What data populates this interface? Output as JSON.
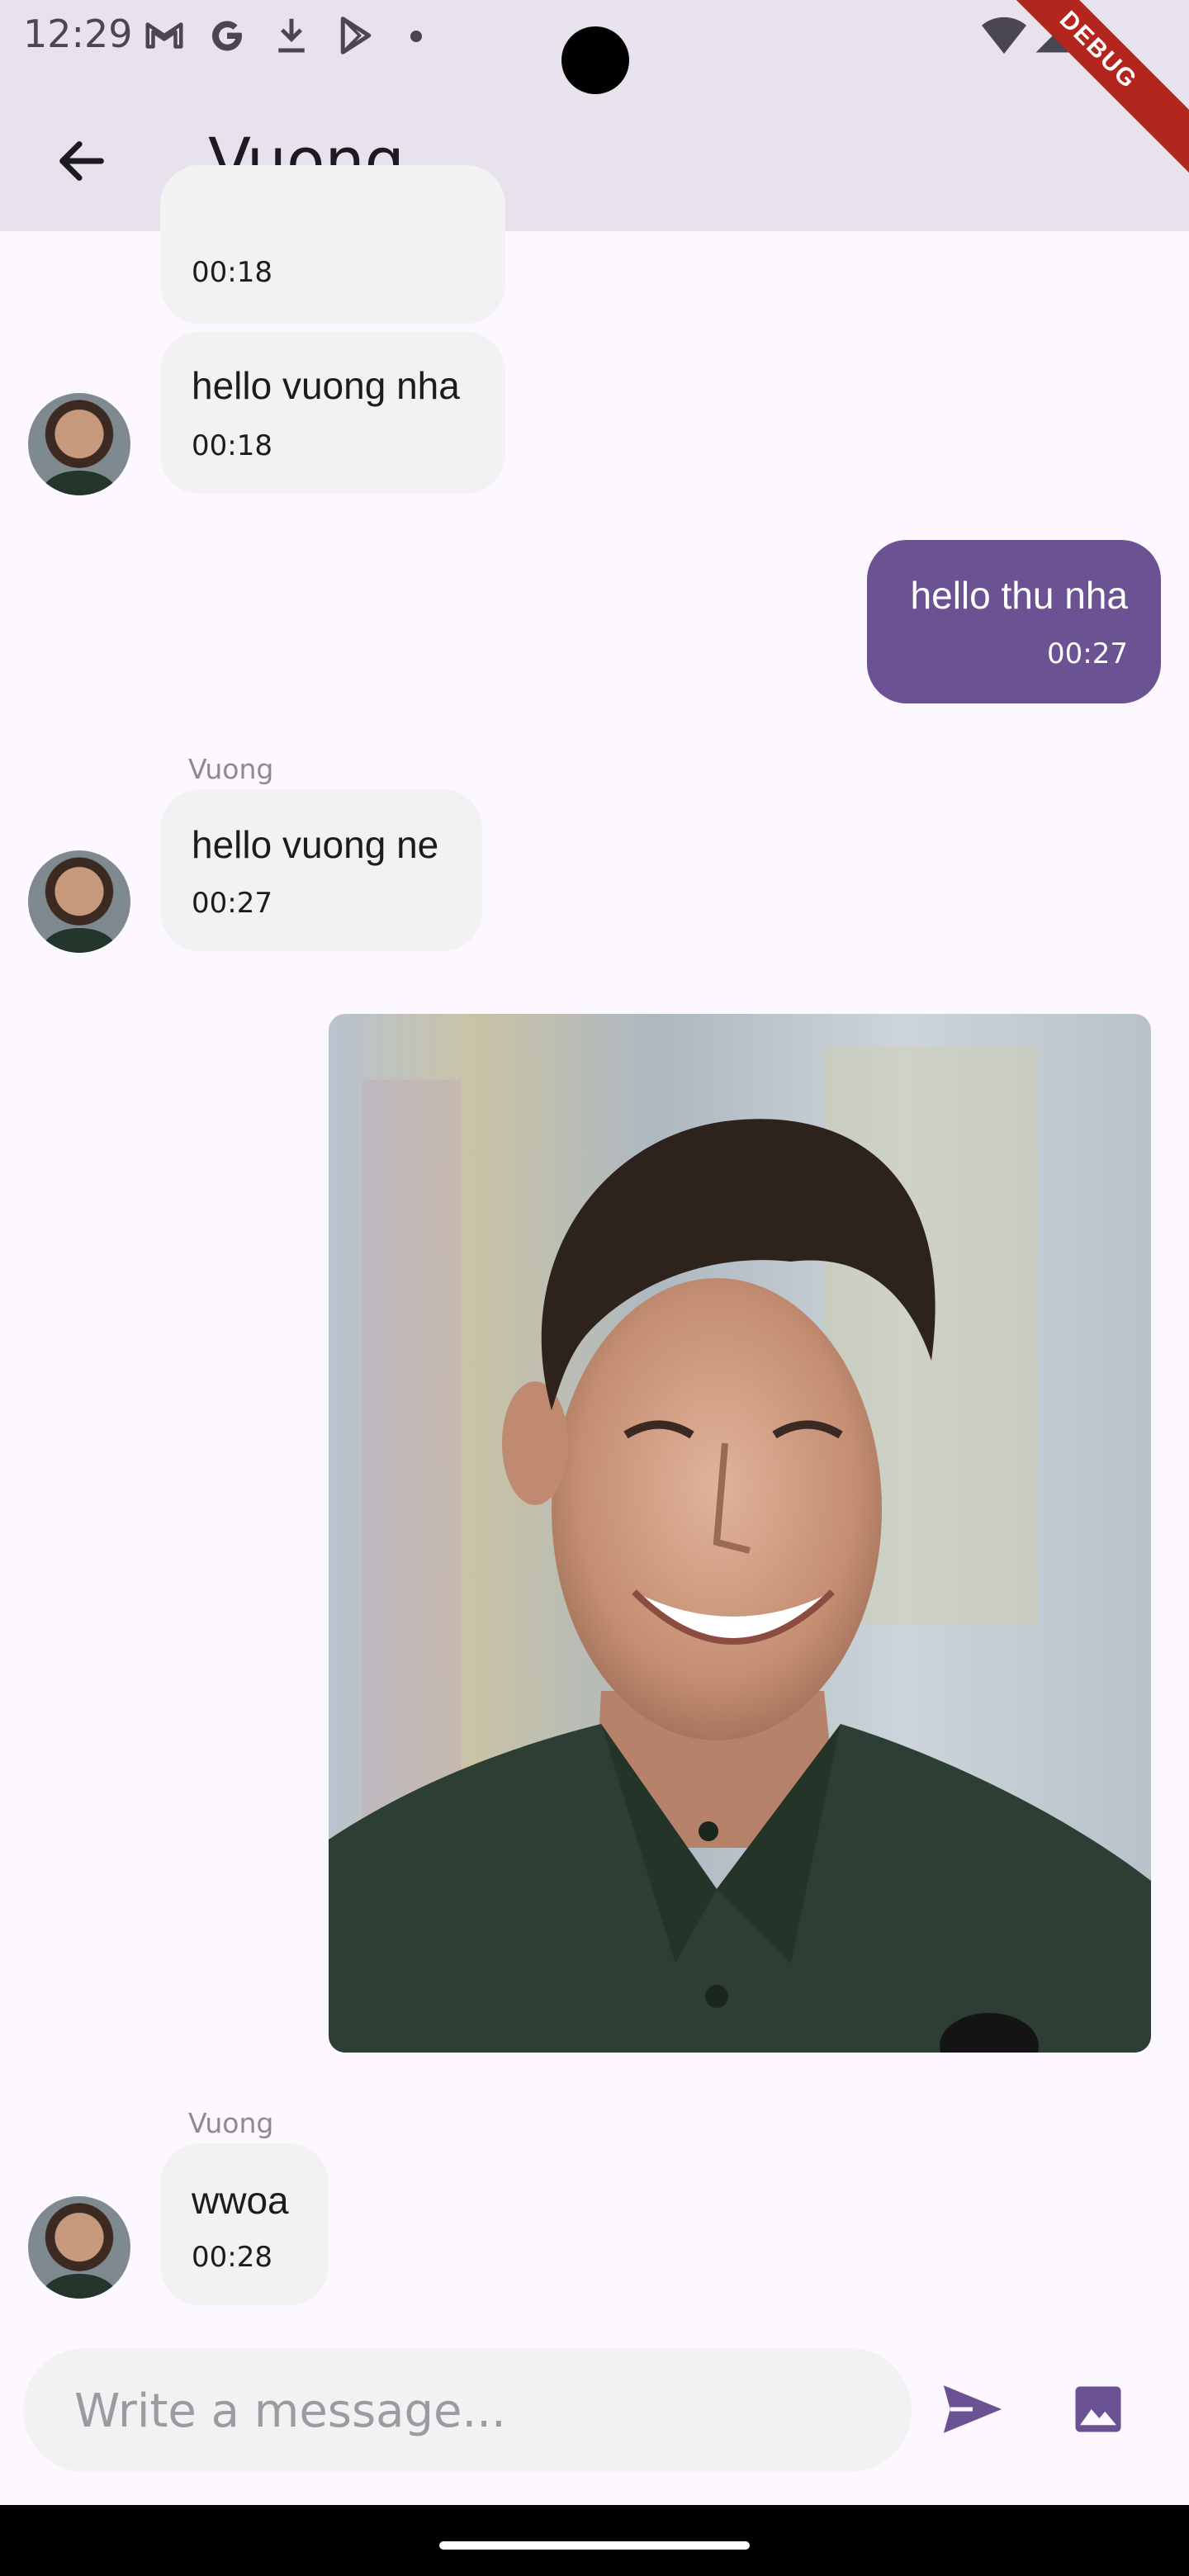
{
  "status_bar": {
    "time": "12:29",
    "icons": [
      "gmail-icon",
      "google-icon",
      "download-icon",
      "play-store-icon",
      "dot-icon",
      "wifi-icon",
      "signal-icon"
    ]
  },
  "debug_banner": "DEBUG",
  "app_bar": {
    "title": "Vuong",
    "back_icon": "arrow-back-icon"
  },
  "messages": [
    {
      "direction": "incoming",
      "text": "hello vuong nha",
      "time": "00:18"
    },
    {
      "direction": "outgoing",
      "text": "hello thu nha",
      "time": "00:27"
    },
    {
      "direction": "incoming",
      "sender": "Vuong",
      "text": "hello vuong ne",
      "time": "00:27"
    },
    {
      "direction": "outgoing",
      "type": "image"
    },
    {
      "direction": "incoming",
      "sender": "Vuong",
      "text": "wwoa",
      "time": "00:28"
    }
  ],
  "partial_message_time": "00:18",
  "composer": {
    "placeholder": "Write a message...",
    "value": "",
    "send_icon": "send-icon",
    "image_icon": "image-icon"
  },
  "colors": {
    "outgoing_bubble": "#6b5293",
    "incoming_bubble": "#f2f2f2",
    "app_bar": "#e8e2ed",
    "background": "#fdf7ff"
  }
}
